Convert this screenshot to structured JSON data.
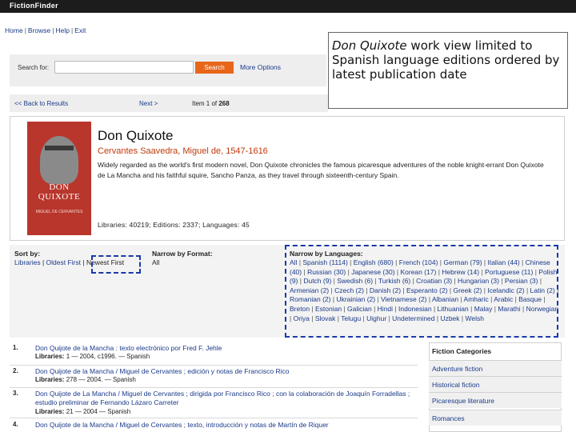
{
  "app": {
    "title": "FictionFinder"
  },
  "nav": {
    "home": "Home",
    "browse": "Browse",
    "help": "Help",
    "exit": "Exit"
  },
  "callout": {
    "title_em": "Don Quixote",
    "text": " work view limited to Spanish language editions ordered by latest publication date"
  },
  "search": {
    "label": "Search for:",
    "button": "Search",
    "more_options": "More Options"
  },
  "results_bar": {
    "back": "<< Back to Results",
    "next": "Next >",
    "item_prefix": "Item 1 of ",
    "item_total": "268"
  },
  "work": {
    "cover_title": "DON QUIXOTE",
    "cover_author": "MIGUEL DE CERVANTES",
    "title": "Don Quixote",
    "author": "Cervantes Saavedra, Miguel de, 1547-1616",
    "description": "Widely regarded as the world's first modern novel, Don Quixote chronicles the famous picaresque adventures of the noble knight-errant Don Quixote de La Mancha and his faithful squire, Sancho Panza, as they travel through sixteenth-century Spain.",
    "stats": "Libraries: 40219; Editions: 2337; Languages: 45"
  },
  "sort": {
    "head": "Sort by:",
    "options": [
      "Libraries",
      "Oldest First",
      "Newest First"
    ]
  },
  "format": {
    "head": "Narrow by Format:",
    "all": "All"
  },
  "languages": {
    "head": "Narrow by Languages:",
    "items": [
      "All",
      "Spanish (1114)",
      "English (680)",
      "French (104)",
      "German (79)",
      "Italian (44)",
      "Chinese (40)",
      "Russian (30)",
      "Japanese (30)",
      "Korean (17)",
      "Hebrew (14)",
      "Portuguese (11)",
      "Polish (9)",
      "Dutch (9)",
      "Swedish (6)",
      "Turkish (6)",
      "Croatian (3)",
      "Hungarian (3)",
      "Persian (3)",
      "Armenian (2)",
      "Czech (2)",
      "Danish (2)",
      "Esperanto (2)",
      "Greek (2)",
      "Icelandic (2)",
      "Latin (2)",
      "Romanian (2)",
      "Ukrainian (2)",
      "Vietnamese (2)",
      "Albanian",
      "Amharic",
      "Arabic",
      "Basque",
      "Breton",
      "Estonian",
      "Galician",
      "Hindi",
      "Indonesian",
      "Lithuanian",
      "Malay",
      "Marathi",
      "Norwegian",
      "Oriya",
      "Slovak",
      "Telugu",
      "Uighur",
      "Undetermined",
      "Uzbek",
      "Welsh"
    ]
  },
  "results": [
    {
      "num": "1.",
      "title": "Don Quijote de la Mancha : texto electrónico por Fred F. Jehle",
      "meta_label": "Libraries:",
      "meta": " 1 — 2004, c1996. — Spanish"
    },
    {
      "num": "2.",
      "title": "Don Quijote de la Mancha / Miguel de Cervantes ; edición y notas de Francisco Rico",
      "meta_label": "Libraries:",
      "meta": " 278 — 2004. — Spanish"
    },
    {
      "num": "3.",
      "title": "Don Quijote de La Mancha / Miguel de Cervantes ; dirigida por Francisco Rico ; con la colaboración de Joaquín Forradellas ; estudio preliminar de Fernando Lázaro Carreter",
      "meta_label": "Libraries:",
      "meta": " 21 — 2004 — Spanish"
    },
    {
      "num": "4.",
      "title": "Don Quijote de la Mancha / Miguel de Cervantes ; texto, introducción y notas de Martín de Riquer",
      "meta_label": "",
      "meta": ""
    }
  ],
  "categories": {
    "head": "Fiction Categories",
    "items": [
      "Adventure fiction",
      "Historical fiction",
      "Picaresque literature",
      "Romances"
    ]
  }
}
